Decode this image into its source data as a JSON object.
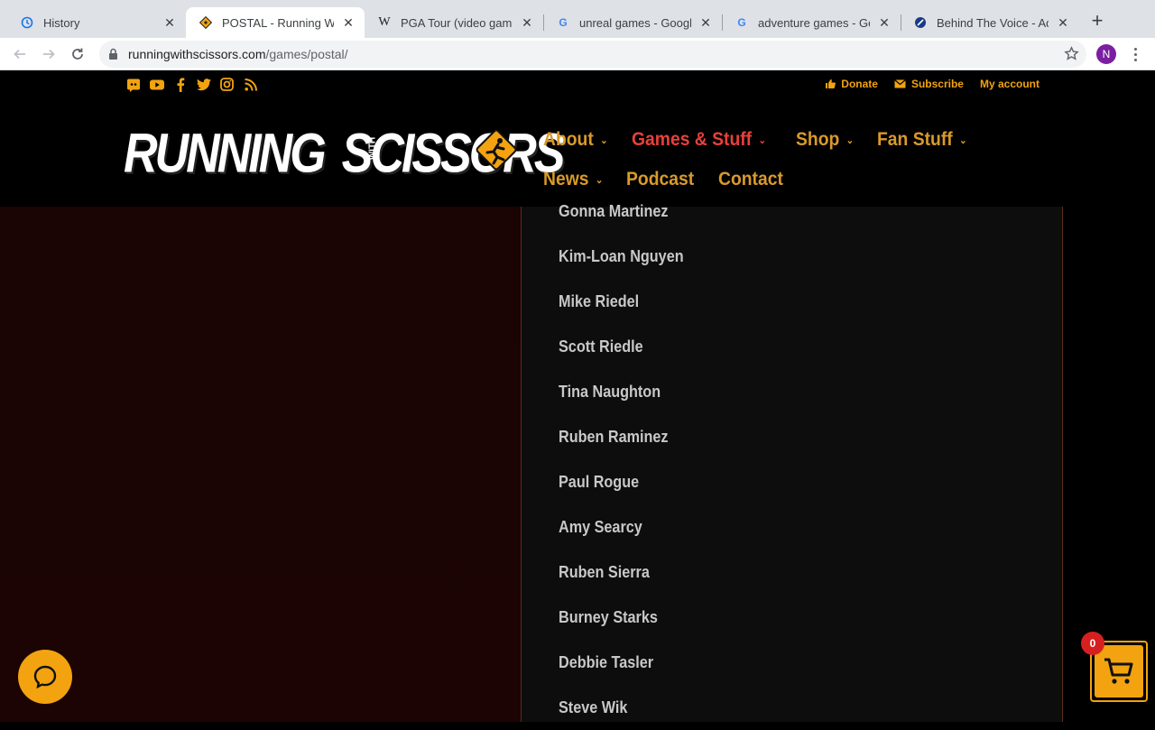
{
  "browser": {
    "tabs": [
      {
        "title": "History",
        "icon": "history-icon"
      },
      {
        "title": "POSTAL - Running With Scissors",
        "icon": "rws-favicon-icon",
        "active": true
      },
      {
        "title": "PGA Tour (video game series)",
        "icon": "wikipedia-icon"
      },
      {
        "title": "unreal games - Google Search",
        "icon": "google-icon"
      },
      {
        "title": "adventure games - Google Search",
        "icon": "google-icon"
      },
      {
        "title": "Behind The Voice - Admin",
        "icon": "btv-icon"
      }
    ],
    "url_domain": "runningwithscissors.com",
    "url_path": "/games/postal/",
    "profile_initial": "N"
  },
  "site": {
    "toplinks": {
      "donate": "Donate",
      "subscribe": "Subscribe",
      "account": "My account"
    },
    "logo": {
      "text_left": "RUNNING",
      "text_with": "WITH",
      "text_right": "SCISSORS"
    },
    "nav": {
      "row1": [
        {
          "label": "About",
          "has_menu": true
        },
        {
          "label": "Games & Stuff",
          "has_menu": true,
          "current": true
        },
        {
          "label": "Shop",
          "has_menu": true
        },
        {
          "label": "Fan Stuff",
          "has_menu": true
        }
      ],
      "row2": [
        {
          "label": "News",
          "has_menu": true
        },
        {
          "label": "Podcast",
          "has_menu": false
        },
        {
          "label": "Contact",
          "has_menu": false
        }
      ]
    },
    "credits": [
      "Gonna Martinez",
      "Kim-Loan Nguyen",
      "Mike Riedel",
      "Scott Riedle",
      "Tina Naughton",
      "Ruben Raminez",
      "Paul Rogue",
      "Amy Searcy",
      "Ruben Sierra",
      "Burney Starks",
      "Debbie Tasler",
      "Steve Wik"
    ],
    "cart_count": "0"
  },
  "colors": {
    "accent": "#f2a30f",
    "nav_text": "#d99a2b",
    "nav_current": "#e8403a",
    "credit_text": "#c8c8c8",
    "left_panel": "#1a0404"
  }
}
